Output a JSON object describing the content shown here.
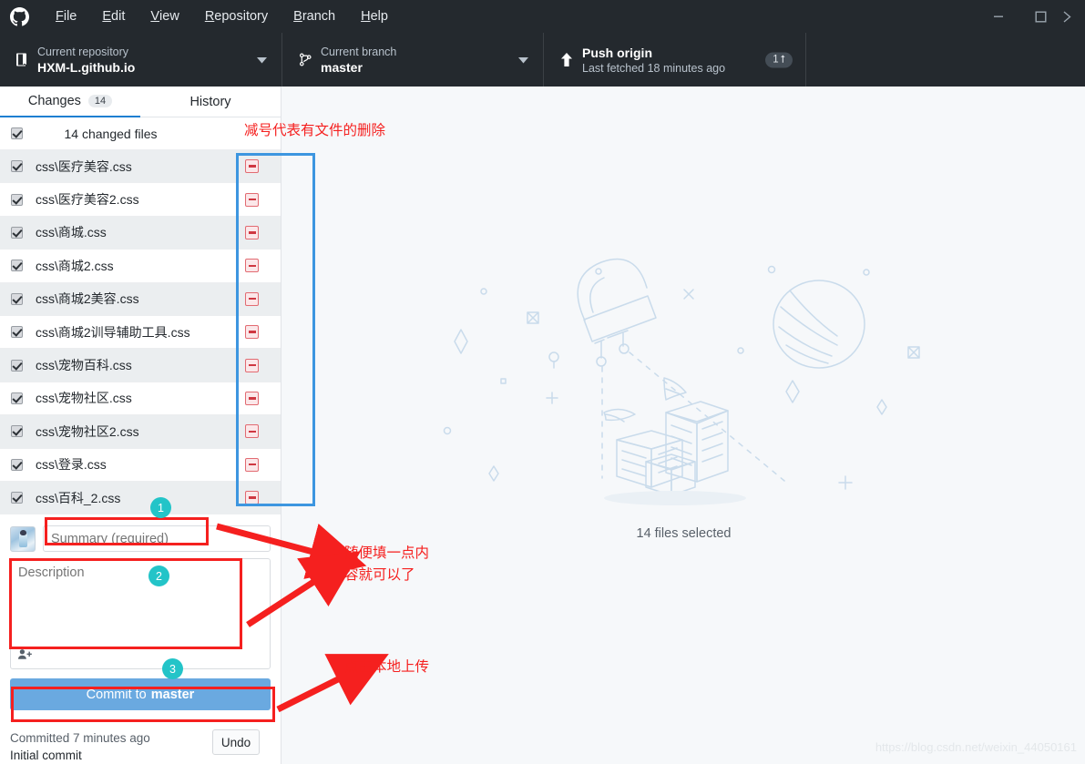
{
  "titlebar": {
    "logo_icon": "github-mark-icon",
    "menus": [
      {
        "label": "File",
        "acc": "F"
      },
      {
        "label": "Edit",
        "acc": "E"
      },
      {
        "label": "View",
        "acc": "V"
      },
      {
        "label": "Repository",
        "acc": "R"
      },
      {
        "label": "Branch",
        "acc": "B"
      },
      {
        "label": "Help",
        "acc": "H"
      }
    ],
    "window_controls": {
      "minimize": "minimize-icon",
      "maximize": "maximize-icon",
      "close": "close-icon"
    }
  },
  "toolbar": {
    "repository": {
      "label": "Current repository",
      "value": "HXM-L.github.io",
      "icon": "repository-book-icon",
      "caret": "chevron-down-icon"
    },
    "branch": {
      "label": "Current branch",
      "value": "master",
      "icon": "branch-icon",
      "caret": "chevron-down-icon"
    },
    "push": {
      "label": "Push origin",
      "sub": "Last fetched 18 minutes ago",
      "icon": "arrow-up-icon",
      "badge_count": "1",
      "badge_arrow": "⭡"
    }
  },
  "sidebar": {
    "tabs": [
      {
        "label": "Changes",
        "count": "14",
        "active": true
      },
      {
        "label": "History",
        "count": "",
        "active": false
      }
    ],
    "changed_files_label": "14 changed files",
    "files": [
      {
        "name": "css\\医疗美容.css",
        "status": "deleted"
      },
      {
        "name": "css\\医疗美容2.css",
        "status": "deleted"
      },
      {
        "name": "css\\商城.css",
        "status": "deleted"
      },
      {
        "name": "css\\商城2.css",
        "status": "deleted"
      },
      {
        "name": "css\\商城2美容.css",
        "status": "deleted"
      },
      {
        "name": "css\\商城2训导辅助工具.css",
        "status": "deleted"
      },
      {
        "name": "css\\宠物百科.css",
        "status": "deleted"
      },
      {
        "name": "css\\宠物社区.css",
        "status": "deleted"
      },
      {
        "name": "css\\宠物社区2.css",
        "status": "deleted"
      },
      {
        "name": "css\\登录.css",
        "status": "deleted"
      },
      {
        "name": "css\\百科_2.css",
        "status": "deleted"
      }
    ],
    "commit": {
      "avatar_icon": "user-avatar",
      "summary_placeholder": "Summary (required)",
      "summary_value": "",
      "description_placeholder": "Description",
      "description_value": "",
      "coauthor_icon": "add-person-icon",
      "button_prefix": "Commit to ",
      "button_branch": "master"
    },
    "footer": {
      "committed_time": "Committed 7 minutes ago",
      "committed_message": "Initial commit",
      "undo_label": "Undo"
    }
  },
  "main": {
    "illustration_icon": "satellite-and-boxes-illustration",
    "files_selected_label": "14 files selected"
  },
  "annotations": {
    "note_minus": "减号代表有文件的删除",
    "note_fill": "随便填一点内\n容就可以了",
    "note_upload": "点击本地上传",
    "badges": [
      "1",
      "2",
      "3"
    ],
    "watermark": "https://blog.csdn.net/weixin_44050161",
    "colors": {
      "annotation_red": "#f5201f",
      "annotation_blue": "#3d96e0",
      "badge_teal": "#23c4c8",
      "commit_button": "#6aa9e0",
      "tab_active": "#1d7fd1"
    }
  }
}
